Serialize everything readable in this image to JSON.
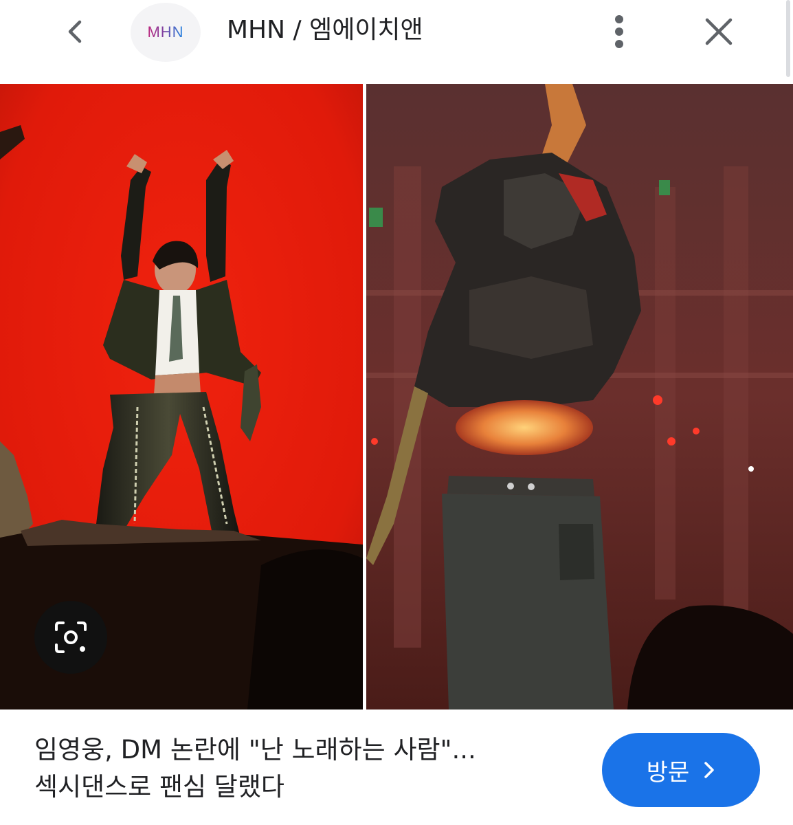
{
  "header": {
    "logo_text": "MHN",
    "site_title": "MHN / 엠에이치앤",
    "icons": [
      "chevron-left-icon",
      "more-vert-icon",
      "close-icon"
    ]
  },
  "image": {
    "lens_icon": "lens-search-icon",
    "brand_colors": {
      "logo_m": "#c0277d",
      "logo_h": "#7b3fa0",
      "logo_n": "#1e88e5"
    }
  },
  "article": {
    "title_line1": "임영웅, DM 논란에 \"난 노래하는 사람\"...",
    "title_line2": "섹시댄스로 팬심 달랬다"
  },
  "visit_button": {
    "label": "방문",
    "color": "#1a73e8"
  }
}
